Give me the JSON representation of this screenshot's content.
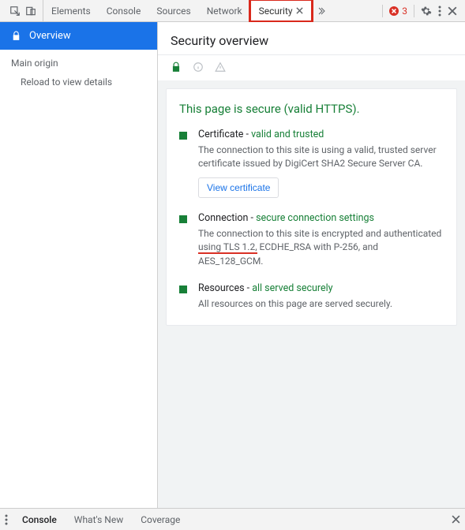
{
  "tabs": {
    "elements": "Elements",
    "console": "Console",
    "sources": "Sources",
    "network": "Network",
    "security": "Security"
  },
  "errors": {
    "count": "3"
  },
  "sidebar": {
    "overview": "Overview",
    "mainOrigin": "Main origin",
    "reload": "Reload to view details"
  },
  "panel": {
    "title": "Security overview",
    "secureLine": "This page is secure (valid HTTPS).",
    "cert": {
      "label": "Certificate",
      "dash": " - ",
      "status": "valid and trusted",
      "desc": "The connection to this site is using a valid, trusted server certificate issued by DigiCert SHA2 Secure Server CA.",
      "button": "View certificate"
    },
    "conn": {
      "label": "Connection",
      "dash": " - ",
      "status": "secure connection settings",
      "descPre": "The connection to this site is encrypted and authenticated ",
      "descUnderline": "using TLS 1.2,",
      "descPost": " ECDHE_RSA with P-256, and AES_128_GCM."
    },
    "res": {
      "label": "Resources",
      "dash": " - ",
      "status": "all served securely",
      "desc": "All resources on this page are served securely."
    }
  },
  "drawer": {
    "console": "Console",
    "whatsnew": "What's New",
    "coverage": "Coverage"
  }
}
